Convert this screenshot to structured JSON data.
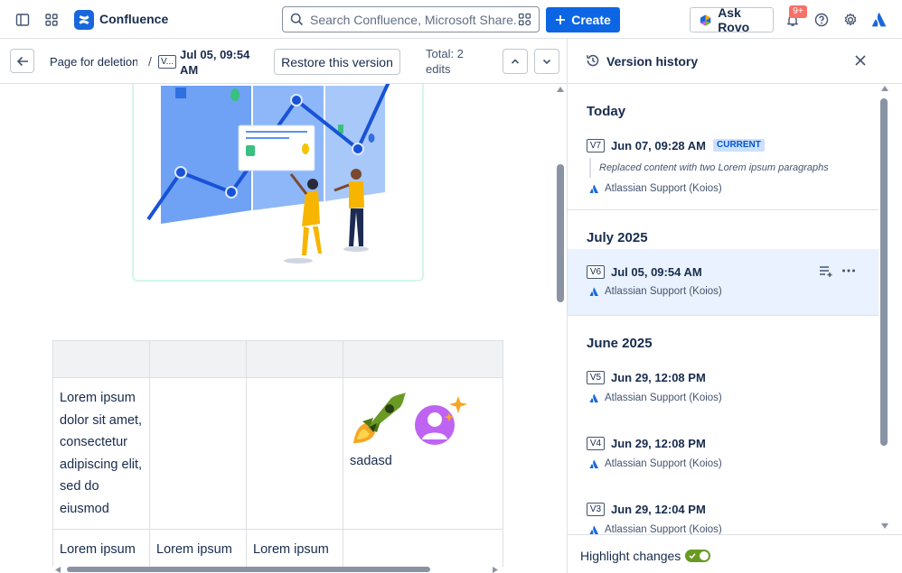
{
  "app": {
    "name": "Confluence",
    "search_placeholder": "Search Confluence, Microsoft Share...",
    "create_label": "Create",
    "ask_rovo_label": "Ask Rovo",
    "notification_count": "9+"
  },
  "toolbar": {
    "page_title": "Page for deletion",
    "separator": "/",
    "version_badge": "V...",
    "version_date": "Jul 05, 09:54 AM",
    "restore_label": "Restore this version",
    "total_edits": "Total: 2 edits"
  },
  "content": {
    "table": {
      "row1": {
        "col1": "Lorem ipsum dolor sit amet, consectetur adipiscing elit, sed do eiusmod",
        "col4": "sadasd"
      },
      "row2": {
        "col1": "Lorem ipsum",
        "col2": "Lorem ipsum",
        "col3": "Lorem ipsum"
      }
    }
  },
  "panel": {
    "title": "Version history",
    "groups": [
      {
        "label": "Today",
        "versions": [
          {
            "badge": "V7",
            "date": "Jun 07, 09:28 AM",
            "tag": "CURRENT",
            "description": "Replaced content with two Lorem ipsum paragraphs",
            "author": "Atlassian Support (Koios)"
          }
        ]
      },
      {
        "label": "July 2025",
        "versions": [
          {
            "badge": "V6",
            "date": "Jul 05, 09:54 AM",
            "author": "Atlassian Support (Koios)"
          }
        ]
      },
      {
        "label": "June 2025",
        "versions": [
          {
            "badge": "V5",
            "date": "Jun 29, 12:08 PM",
            "author": "Atlassian Support (Koios)"
          },
          {
            "badge": "V4",
            "date": "Jun 29, 12:08 PM",
            "author": "Atlassian Support (Koios)"
          },
          {
            "badge": "V3",
            "date": "Jun 29, 12:04 PM",
            "author": "Atlassian Support (Koios)"
          }
        ]
      }
    ],
    "highlight_label": "Highlight changes",
    "highlight_on": true
  },
  "colors": {
    "primary": "#0c66e4",
    "selected_row": "#e9f2fe",
    "toggle_on": "#6a9a23",
    "current_badge_bg": "#cce0ff",
    "notification": "#f87168"
  }
}
